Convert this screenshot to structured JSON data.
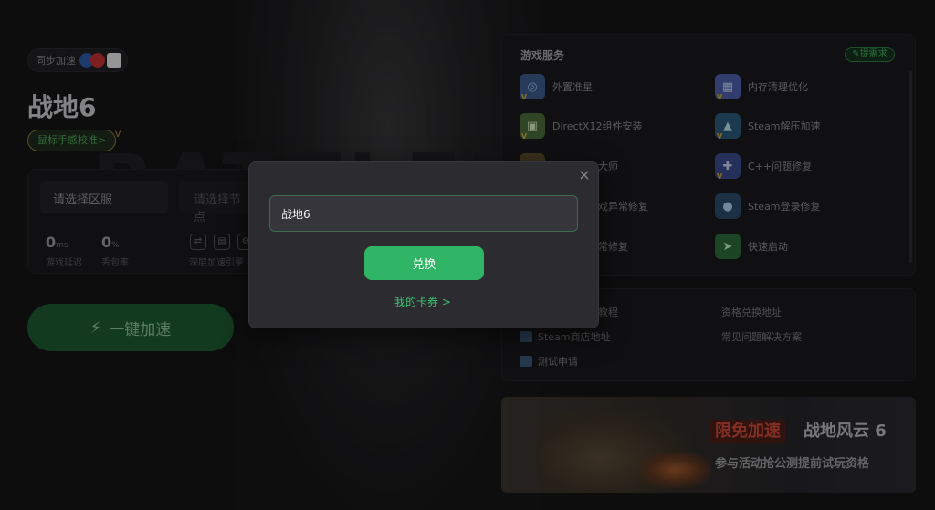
{
  "sync": {
    "label": "同步加速"
  },
  "game": {
    "title": "战地6",
    "calibration": "鼠标手感校准>",
    "region_placeholder": "请选择区服",
    "node_placeholder": "请选择节点",
    "stats": [
      {
        "value": "0",
        "unit": "ms",
        "label": "游戏延迟"
      },
      {
        "value": "0",
        "unit": "%",
        "label": "丢包率"
      }
    ],
    "deep_accel": "深层加速引擎",
    "accel_button": "一键加速"
  },
  "services": {
    "title": "游戏服务",
    "request_badge": "提需求",
    "items": [
      {
        "label": "外置准星",
        "icon": "crosshair-icon",
        "color": "#3b5b8a",
        "vip": true
      },
      {
        "label": "内存清理优化",
        "icon": "memory-icon",
        "color": "#4a5fa8",
        "vip": true
      },
      {
        "label": "DirectX12组件安装",
        "icon": "directx-icon",
        "color": "#4a6a3a",
        "vip": true
      },
      {
        "label": "Steam解压加速",
        "icon": "steam-unzip-icon",
        "color": "#2a5a7a",
        "vip": true
      },
      {
        "label": "大师",
        "icon": "master-icon",
        "color": "#5a4a2a",
        "vip": true
      },
      {
        "label": "C++问题修复",
        "icon": "cpp-repair-icon",
        "color": "#3a4a8a",
        "vip": true
      },
      {
        "label": "戏异常修复",
        "icon": "game-repair-icon",
        "color": "#4a3a3a",
        "vip": false
      },
      {
        "label": "Steam登录修复",
        "icon": "steam-login-icon",
        "color": "#2a4a6a",
        "vip": false
      },
      {
        "label": "常修复",
        "icon": "repair-icon",
        "color": "#3a3a3a",
        "vip": false
      },
      {
        "label": "快速启动",
        "icon": "quick-start-icon",
        "color": "#2a6a3a",
        "vip": false
      }
    ],
    "links": [
      {
        "label": "教程"
      },
      {
        "label": "资格兑换地址"
      },
      {
        "label": "Steam商店地址"
      },
      {
        "label": "常见问题解决方案"
      },
      {
        "label": "测试申请"
      }
    ]
  },
  "banner": {
    "promo": "限免加速",
    "game": "战地风云 6",
    "subtitle": "参与活动抢公测提前试玩资格"
  },
  "modal": {
    "close": "×",
    "code_value": "战地6",
    "redeem_label": "兑换",
    "coupon_link": "我的卡券 >"
  },
  "colors": {
    "accent": "#2fb565",
    "panel": "#1a1a1d",
    "modal": "#2b2b30"
  }
}
